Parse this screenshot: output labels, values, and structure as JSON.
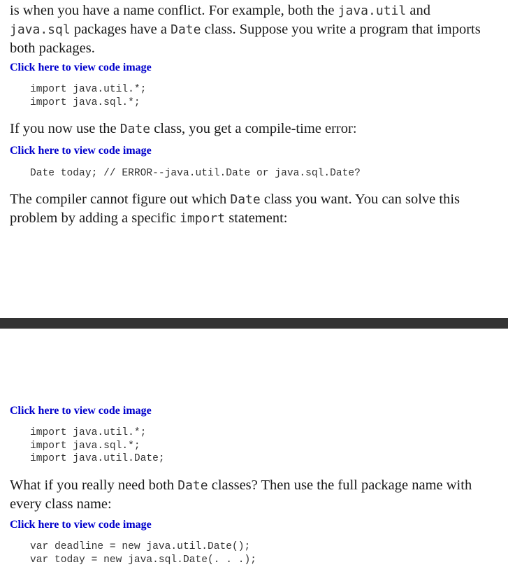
{
  "paragraphs": {
    "p1": {
      "t1": "is when you have a name conflict. For example, both the ",
      "c1": "java.util",
      "t2": " and ",
      "c2": "java.sql",
      "t3": " packages have a ",
      "c3": "Date",
      "t4": " class. Suppose you write a program that imports both packages."
    },
    "p2": {
      "t1": "If you now use the ",
      "c1": "Date",
      "t2": " class, you get a compile-time error:"
    },
    "p3": {
      "t1": "The compiler cannot figure out which ",
      "c1": "Date",
      "t2": " class you want. You can solve this problem by adding a specific ",
      "c2": "import",
      "t3": " statement:"
    },
    "p4": {
      "t1": "What if you really need both ",
      "c1": "Date",
      "t2": " classes? Then use the full package name with every class name:"
    }
  },
  "links": {
    "code_image_label": "Click here to view code image"
  },
  "code_blocks": {
    "b1": "import java.util.*;\nimport java.sql.*;",
    "b2": "Date today; // ERROR--java.util.Date or java.sql.Date?",
    "b3": "import java.util.*;\nimport java.sql.*;\nimport java.util.Date;",
    "b4": "var deadline = new java.util.Date();\nvar today = new java.sql.Date(. . .);"
  },
  "colors": {
    "link": "#0000cc",
    "text": "#1a1a1a",
    "code": "#333333",
    "page_break": "#333333"
  }
}
